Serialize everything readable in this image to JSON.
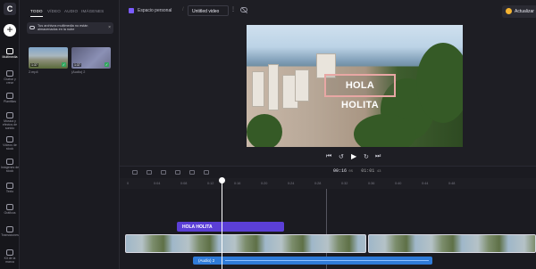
{
  "app": {
    "logo_letter": "C"
  },
  "rail": {
    "items": [
      {
        "label": "Multimedia",
        "icon": "folder-icon",
        "active": true
      },
      {
        "label": "Grabar y crear",
        "icon": "record-icon"
      },
      {
        "label": "Plantillas",
        "icon": "templates-icon"
      },
      {
        "label": "Música y efectos de sonido",
        "icon": "music-icon"
      },
      {
        "label": "Vídeos de stock",
        "icon": "stock-video-icon"
      },
      {
        "label": "Imágenes de stock",
        "icon": "stock-image-icon"
      },
      {
        "label": "Texto",
        "icon": "text-icon"
      },
      {
        "label": "Gráficos",
        "icon": "graphics-icon"
      },
      {
        "label": "Transiciones",
        "icon": "transitions-icon"
      },
      {
        "label": "Kit de la marca",
        "icon": "brand-kit-icon"
      }
    ]
  },
  "media": {
    "tabs": [
      "TODO",
      "VÍDEO",
      "AUDIO",
      "IMÁGENES"
    ],
    "notice": "Tus archivos multimedia no están almacenados en la nube",
    "items": [
      {
        "name": "2.mp4",
        "duration": "1:37"
      },
      {
        "name": "(Audio) 2",
        "duration": "1:37"
      }
    ]
  },
  "topbar": {
    "workspace": "Espacio personal",
    "separator": "/",
    "project_title": "Untitled video",
    "menu": "⋮",
    "update_label": "Actualizar"
  },
  "preview": {
    "overlay_text": "HOLA HOLITA"
  },
  "controls": {
    "prev": "⏮",
    "rewind": "↺",
    "play": "▶",
    "forward": "↻",
    "next": "⏭"
  },
  "timeline": {
    "current_time": "00:16",
    "current_frac": "05",
    "total_time": "01:01",
    "total_frac": "43",
    "ticks": [
      "0",
      "0:04",
      "0:08",
      "0:12",
      "0:16",
      "0:20",
      "0:24",
      "0:28",
      "0:32",
      "0:36",
      "0:40",
      "0:44",
      "0:48"
    ],
    "text_clip": "HOLA HOLITA",
    "audio_clip": "(Audio) 2"
  },
  "colors": {
    "text_clip": "#5b3fd6",
    "audio_clip": "#2f7bd8",
    "accent": "#7b5cff",
    "update_crown": "#f5b431"
  }
}
